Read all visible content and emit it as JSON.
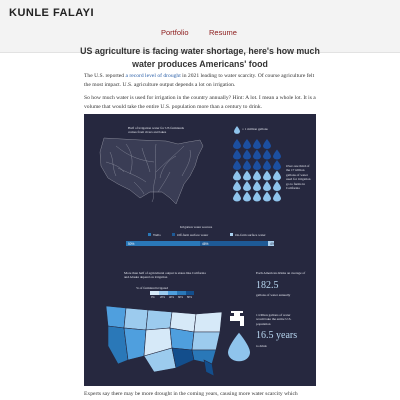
{
  "site": {
    "brand": "KUNLE FALAYI",
    "nav": [
      "Portfolio",
      "Resume"
    ]
  },
  "article": {
    "title": "US agriculture is facing water shortage, here's how much water produces Americans' food",
    "p1_before": "The U.S. reported ",
    "p1_link": "a record level of drought",
    "p1_after": " in 2021 leading to water scarcity. Of course agriculture felt the most impact. U.S. agriculture output depends a lot on irrigation.",
    "p2": "So how much water is used for irrigation in the country annually? Hint: A lot. I mean a whole lot. It is a volume that would take the entire U.S. population more than a century to drink.",
    "p3": "Experts say there may be more drought in the coming years, causing more water scarcity which"
  },
  "infographic": {
    "map_caption": "Half of irrigation water for US farmlands comes from rivers and lakes",
    "drop_legend": "= 1 million gallons",
    "drops_note": "Over one third of the 17 trillion gallons of water used for irrigation go to farms in California",
    "sources_title": "Irrigation water sources",
    "source_legend": [
      "Wells",
      "Off-farm surface water",
      "On-farm surface water"
    ],
    "bar_labels": [
      "50%",
      "46%",
      "4%"
    ],
    "bar_values": [
      50,
      46,
      4
    ],
    "map2_caption": "More than half of agricultural output is states like California and Alaska depend on irrigation",
    "map2_legend_title": "% of farmland irrigated",
    "map2_legend_values": [
      "0%",
      "20%",
      "40%",
      "60%",
      "80%"
    ],
    "drink_intro": "Each American drinks an average of",
    "drink_value": "182.5",
    "drink_unit": "gallons of water annually",
    "drink_note": "1 trillion gallons of water would take the entire U.S. population",
    "years_value": "16.5 years",
    "years_tail": "to drink",
    "colors": {
      "background": "#26283f",
      "wells": "#2a78b8",
      "off_farm": "#1e5a96",
      "on_farm": "#aad0ef",
      "drop": "#1c4fa0",
      "drop_light": "#8fc4ec",
      "river": "#8a8c9a"
    }
  }
}
